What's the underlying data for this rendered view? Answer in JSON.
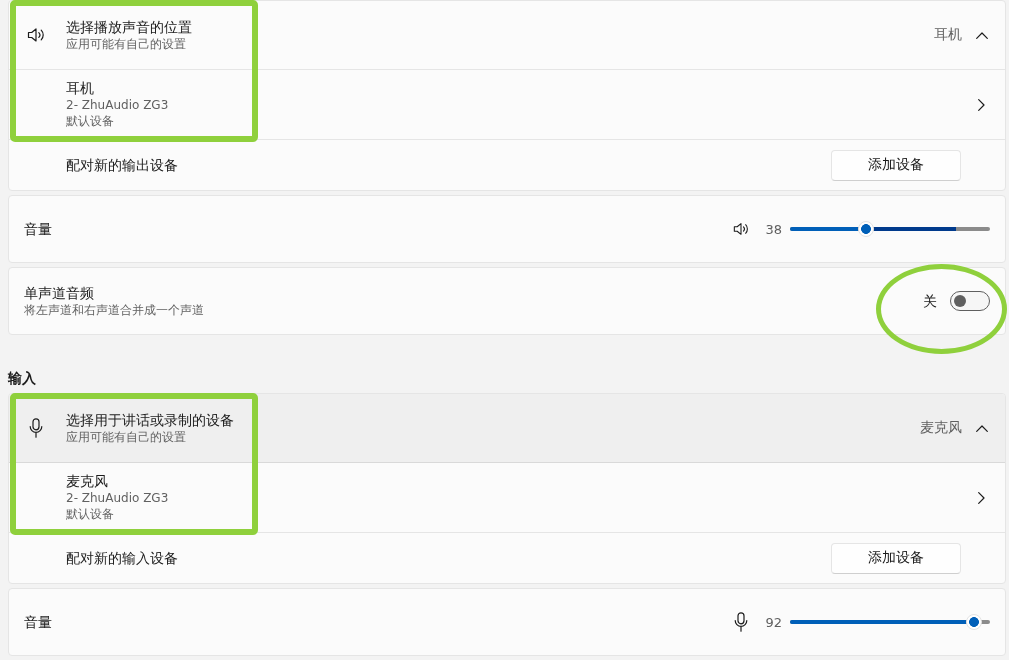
{
  "output": {
    "picker": {
      "title": "选择播放声音的位置",
      "subtitle": "应用可能有自己的设置",
      "current": "耳机",
      "expanded": true,
      "hovered": false,
      "highlighted": true
    },
    "device": {
      "name": "耳机",
      "model": "2- ZhuAudio ZG3",
      "status": "默认设备"
    },
    "pair": {
      "label": "配对新的输出设备",
      "button": "添加设备"
    },
    "volume": {
      "label": "音量",
      "reading": "38",
      "level": 0.38,
      "peak_meter": {
        "level": 0.75
      }
    },
    "mono_audio": {
      "title": "单声道音频",
      "subtitle": "将左声道和右声道合并成一个声道",
      "state_label": "关",
      "on": false,
      "circled": true
    }
  },
  "input": {
    "heading": "输入",
    "picker": {
      "title": "选择用于讲话或录制的设备",
      "subtitle": "应用可能有自己的设置",
      "current": "麦克风",
      "expanded": true,
      "hovered": true,
      "highlighted": true
    },
    "device": {
      "name": "麦克风",
      "model": "2- ZhuAudio ZG3",
      "status": "默认设备"
    },
    "pair": {
      "label": "配对新的输入设备",
      "button": "添加设备"
    },
    "volume": {
      "label": "音量",
      "reading": "92",
      "level": 0.92
    }
  }
}
